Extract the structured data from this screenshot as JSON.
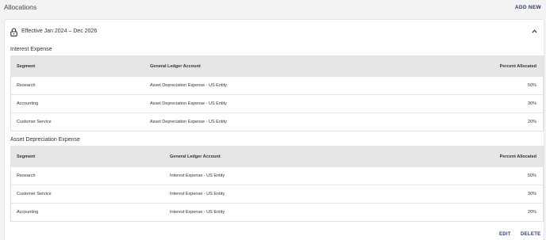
{
  "header": {
    "title": "Allocations",
    "add_new_label": "ADD NEW"
  },
  "card": {
    "effective_label": "Effective Jan 2024 – Dec 2026",
    "icons": {
      "lock": "lock-icon",
      "collapse": "chevron-up-icon"
    },
    "sections": [
      {
        "title": "Interest Expense",
        "columns": [
          "Segment",
          "General Ledger Account",
          "Percent Allocated"
        ],
        "rows": [
          {
            "segment": "Research",
            "gl_account": "Asset Depreciation Expense - US Entity",
            "percent": "50%"
          },
          {
            "segment": "Accounting",
            "gl_account": "Asset Depreciation Expense - US Entity",
            "percent": "30%"
          },
          {
            "segment": "Customer Service",
            "gl_account": "Asset Depreciation Expense - US Entity",
            "percent": "20%"
          }
        ]
      },
      {
        "title": "Asset Depreciation Expense",
        "columns": [
          "Segment",
          "General Ledger Account",
          "Percent Allocated"
        ],
        "rows": [
          {
            "segment": "Research",
            "gl_account": "Interest Expense - US Entity",
            "percent": "50%"
          },
          {
            "segment": "Customer Service",
            "gl_account": "Interest Expense - US Entity",
            "percent": "30%"
          },
          {
            "segment": "Accounting",
            "gl_account": "Interest Expense - US Entity",
            "percent": "20%"
          }
        ]
      }
    ],
    "actions": {
      "edit_label": "EDIT",
      "delete_label": "DELETE"
    }
  }
}
